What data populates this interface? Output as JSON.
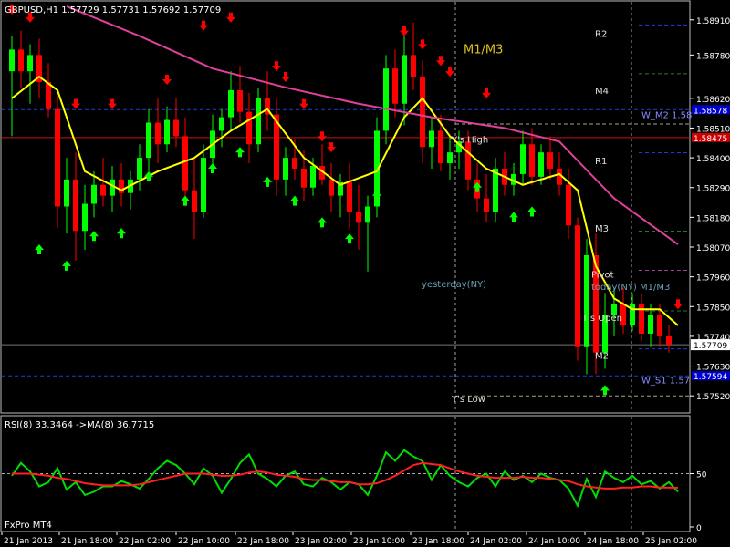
{
  "chart_data": [
    {
      "type": "candlestick",
      "title": "GBPUSD,H1  1.57729 1.57731 1.57692 1.57709",
      "current_price": "1.57709",
      "y_ticks": [
        "1.58910",
        "1.58780",
        "1.58620",
        "1.58510",
        "1.58400",
        "1.58290",
        "1.58180",
        "1.58070",
        "1.57960",
        "1.57850",
        "1.57740",
        "1.57630",
        "1.57520"
      ],
      "ylim": [
        1.5746,
        1.5898
      ],
      "level_boxes": [
        {
          "label": "1.58475",
          "price": 1.58475,
          "bg": "#cc0000"
        },
        {
          "label": "1.58578",
          "price": 1.58578,
          "bg": "#0000cc"
        },
        {
          "label": "1.57594",
          "price": 1.57594,
          "bg": "#0000cc"
        }
      ],
      "candles": [
        [
          1.5872,
          1.5885,
          1.5848,
          1.588
        ],
        [
          1.588,
          1.5887,
          1.5866,
          1.5872
        ],
        [
          1.5872,
          1.5882,
          1.586,
          1.5878
        ],
        [
          1.5878,
          1.5884,
          1.5862,
          1.5868
        ],
        [
          1.5868,
          1.5875,
          1.5855,
          1.5858
        ],
        [
          1.5858,
          1.5863,
          1.5814,
          1.5822
        ],
        [
          1.5822,
          1.584,
          1.5812,
          1.5832
        ],
        [
          1.5832,
          1.5842,
          1.5802,
          1.5813
        ],
        [
          1.5813,
          1.583,
          1.5806,
          1.5823
        ],
        [
          1.5823,
          1.5835,
          1.5818,
          1.583
        ],
        [
          1.583,
          1.584,
          1.5822,
          1.5826
        ],
        [
          1.5826,
          1.5837,
          1.582,
          1.5832
        ],
        [
          1.5832,
          1.5838,
          1.5822,
          1.5827
        ],
        [
          1.5827,
          1.5835,
          1.5821,
          1.5832
        ],
        [
          1.5832,
          1.5845,
          1.5828,
          1.584
        ],
        [
          1.584,
          1.5858,
          1.5835,
          1.5853
        ],
        [
          1.5853,
          1.5862,
          1.5838,
          1.5845
        ],
        [
          1.5845,
          1.5859,
          1.5842,
          1.5854
        ],
        [
          1.5854,
          1.5862,
          1.5844,
          1.5848
        ],
        [
          1.5848,
          1.5855,
          1.5822,
          1.5828
        ],
        [
          1.5828,
          1.584,
          1.581,
          1.582
        ],
        [
          1.582,
          1.5845,
          1.5818,
          1.584
        ],
        [
          1.584,
          1.5856,
          1.5836,
          1.585
        ],
        [
          1.585,
          1.5858,
          1.5844,
          1.5855
        ],
        [
          1.5855,
          1.5872,
          1.585,
          1.5865
        ],
        [
          1.5865,
          1.5874,
          1.5853,
          1.5857
        ],
        [
          1.5857,
          1.5864,
          1.5838,
          1.5845
        ],
        [
          1.5845,
          1.5866,
          1.5842,
          1.5862
        ],
        [
          1.5862,
          1.5872,
          1.585,
          1.5856
        ],
        [
          1.5856,
          1.5862,
          1.5826,
          1.5832
        ],
        [
          1.5832,
          1.5844,
          1.5826,
          1.584
        ],
        [
          1.584,
          1.5847,
          1.5832,
          1.5836
        ],
        [
          1.5836,
          1.5843,
          1.5824,
          1.5829
        ],
        [
          1.5829,
          1.584,
          1.5826,
          1.5837
        ],
        [
          1.5837,
          1.5845,
          1.583,
          1.5832
        ],
        [
          1.5832,
          1.5838,
          1.582,
          1.5826
        ],
        [
          1.5826,
          1.5834,
          1.5818,
          1.5831
        ],
        [
          1.5831,
          1.5838,
          1.5814,
          1.582
        ],
        [
          1.582,
          1.583,
          1.5806,
          1.5816
        ],
        [
          1.5816,
          1.5826,
          1.5798,
          1.5822
        ],
        [
          1.5822,
          1.5855,
          1.5818,
          1.585
        ],
        [
          1.585,
          1.5878,
          1.5845,
          1.5873
        ],
        [
          1.5873,
          1.588,
          1.5855,
          1.586
        ],
        [
          1.586,
          1.5885,
          1.5852,
          1.5878
        ],
        [
          1.5878,
          1.589,
          1.5865,
          1.587
        ],
        [
          1.587,
          1.5876,
          1.5838,
          1.5844
        ],
        [
          1.5844,
          1.5855,
          1.5836,
          1.585
        ],
        [
          1.585,
          1.5856,
          1.5835,
          1.5838
        ],
        [
          1.5838,
          1.5848,
          1.5832,
          1.5842
        ],
        [
          1.5842,
          1.585,
          1.5836,
          1.5846
        ],
        [
          1.5846,
          1.585,
          1.5828,
          1.5832
        ],
        [
          1.5832,
          1.5838,
          1.582,
          1.5825
        ],
        [
          1.5825,
          1.5834,
          1.5816,
          1.582
        ],
        [
          1.582,
          1.584,
          1.5816,
          1.5836
        ],
        [
          1.5836,
          1.5842,
          1.5826,
          1.583
        ],
        [
          1.583,
          1.5838,
          1.5826,
          1.5834
        ],
        [
          1.5834,
          1.585,
          1.583,
          1.5845
        ],
        [
          1.5845,
          1.5851,
          1.583,
          1.5833
        ],
        [
          1.5833,
          1.5845,
          1.583,
          1.5842
        ],
        [
          1.5842,
          1.5848,
          1.5832,
          1.5836
        ],
        [
          1.5836,
          1.5842,
          1.5826,
          1.583
        ],
        [
          1.583,
          1.5836,
          1.581,
          1.5815
        ],
        [
          1.5815,
          1.5818,
          1.5765,
          1.577
        ],
        [
          1.577,
          1.581,
          1.576,
          1.5804
        ],
        [
          1.5804,
          1.5812,
          1.576,
          1.5768
        ],
        [
          1.5768,
          1.579,
          1.5762,
          1.5782
        ],
        [
          1.5782,
          1.5792,
          1.5774,
          1.5786
        ],
        [
          1.5786,
          1.5792,
          1.5775,
          1.5778
        ],
        [
          1.5778,
          1.579,
          1.5776,
          1.5786
        ],
        [
          1.5786,
          1.579,
          1.5772,
          1.5775
        ],
        [
          1.5775,
          1.5786,
          1.577,
          1.5782
        ],
        [
          1.5782,
          1.5786,
          1.577,
          1.5774
        ],
        [
          1.5774,
          1.5778,
          1.5768,
          1.5771
        ]
      ],
      "ma": [
        {
          "name": "MA yellow",
          "color": "#ffff00",
          "points": [
            [
              0,
              1.5862
            ],
            [
              3,
              1.587
            ],
            [
              5,
              1.5865
            ],
            [
              8,
              1.5835
            ],
            [
              12,
              1.5828
            ],
            [
              16,
              1.5835
            ],
            [
              20,
              1.584
            ],
            [
              24,
              1.585
            ],
            [
              28,
              1.5858
            ],
            [
              32,
              1.584
            ],
            [
              36,
              1.583
            ],
            [
              40,
              1.5835
            ],
            [
              43,
              1.5855
            ],
            [
              45,
              1.5862
            ],
            [
              48,
              1.5848
            ],
            [
              52,
              1.5836
            ],
            [
              56,
              1.583
            ],
            [
              60,
              1.5834
            ],
            [
              62,
              1.5828
            ],
            [
              64,
              1.58
            ],
            [
              66,
              1.5788
            ],
            [
              68,
              1.5784
            ],
            [
              71,
              1.5784
            ],
            [
              73,
              1.5778
            ]
          ]
        },
        {
          "name": "MA pink",
          "color": "#e0409a",
          "points": [
            [
              6,
              1.5896
            ],
            [
              14,
              1.5885
            ],
            [
              22,
              1.5873
            ],
            [
              30,
              1.5866
            ],
            [
              38,
              1.586
            ],
            [
              46,
              1.5855
            ],
            [
              54,
              1.5851
            ],
            [
              60,
              1.5846
            ],
            [
              66,
              1.5825
            ],
            [
              73,
              1.5808
            ]
          ]
        }
      ],
      "h_lines": [
        {
          "price": 1.58891,
          "color": "#1b3fd6",
          "dash": true,
          "x_from": 700
        },
        {
          "price": 1.58578,
          "color": "#1b3fd6",
          "dash": true,
          "x_from": 0
        },
        {
          "price": 1.58475,
          "color": "#c81414",
          "dash": false,
          "x_from": 0
        },
        {
          "price": 1.57594,
          "color": "#1b3fd6",
          "dash": true,
          "x_from": 0
        },
        {
          "price": 1.57709,
          "color": "#777777",
          "dash": false,
          "x_from": 0
        },
        {
          "price": 1.58711,
          "color": "#2a7a2a",
          "dash": true,
          "x_from": 700
        },
        {
          "price": 1.58419,
          "color": "#1b3fd6",
          "dash": true,
          "x_from": 700
        },
        {
          "price": 1.58129,
          "color": "#2a7a2a",
          "dash": true,
          "x_from": 700
        },
        {
          "price": 1.57984,
          "color": "#a040a0",
          "dash": true,
          "x_from": 700
        },
        {
          "price": 1.57834,
          "color": "#2a7a2a",
          "dash": true,
          "x_from": 700
        },
        {
          "price": 1.57694,
          "color": "#1b3fd6",
          "dash": true,
          "x_from": 700
        },
        {
          "price": 1.58525,
          "color": "#b0a080",
          "dash": true,
          "x_from": 499
        },
        {
          "price": 1.5752,
          "color": "#b0a080",
          "dash": true,
          "x_from": 499
        }
      ],
      "v_lines": [
        {
          "time": "23 Jan 22:00",
          "color": "#a0a0a0"
        },
        {
          "time": "24 Jan 22:00",
          "color": "#a0a0a0"
        }
      ],
      "labels": [
        {
          "text": "R2",
          "price": 1.5886,
          "color": "#e0e0e0",
          "pos": "right"
        },
        {
          "text": "M4",
          "price": 1.5865,
          "color": "#e0e0e0",
          "pos": "right"
        },
        {
          "text": "R1",
          "price": 1.5839,
          "color": "#e0e0e0",
          "pos": "right"
        },
        {
          "text": "M3",
          "price": 1.5814,
          "color": "#e0e0e0",
          "pos": "right"
        },
        {
          "text": "M2",
          "price": 1.5767,
          "color": "#e0e0e0",
          "pos": "right"
        },
        {
          "text": "W_M2 1.58",
          "price": 1.5856,
          "color": "#8a8aff",
          "pos": "far"
        },
        {
          "text": "W_S1 1.57",
          "price": 1.5758,
          "color": "#8a8aff",
          "pos": "far"
        },
        {
          "text": "M1/M3",
          "price": 1.588,
          "color": "#e0c020",
          "pos": "mid",
          "size": 13
        },
        {
          "text": "Y's High",
          "price": 1.5847,
          "color": "#e0e0e0",
          "pos": "low"
        },
        {
          "text": "Y's Low",
          "price": 1.5751,
          "color": "#e0e0e0",
          "pos": "low"
        },
        {
          "text": "yesterday(NY)",
          "price": 1.57935,
          "color": "#6a9fb5",
          "pos": "y"
        },
        {
          "text": "Pivot",
          "price": 1.5797,
          "color": "#e0e0e0",
          "pos": "piv"
        },
        {
          "text": "today(NY) M1/M3",
          "price": 1.57925,
          "color": "#6a9fb5",
          "pos": "tod"
        },
        {
          "text": "T's Open",
          "price": 1.5781,
          "color": "#e0e0e0",
          "pos": "top"
        }
      ],
      "up_arrows": [
        [
          3,
          1.5808
        ],
        [
          6,
          1.5802
        ],
        [
          9,
          1.5813
        ],
        [
          12,
          1.5814
        ],
        [
          15,
          1.5835
        ],
        [
          19,
          1.5826
        ],
        [
          22,
          1.5838
        ],
        [
          25,
          1.5844
        ],
        [
          28,
          1.5833
        ],
        [
          31,
          1.5826
        ],
        [
          34,
          1.5818
        ],
        [
          37,
          1.5812
        ],
        [
          40,
          1.5828
        ],
        [
          51,
          1.5831
        ],
        [
          55,
          1.582
        ],
        [
          57,
          1.5822
        ],
        [
          65,
          1.5756
        ]
      ],
      "down_arrows": [
        [
          0,
          1.5893
        ],
        [
          2,
          1.589
        ],
        [
          7,
          1.5858
        ],
        [
          11,
          1.5858
        ],
        [
          17,
          1.5867
        ],
        [
          21,
          1.5887
        ],
        [
          24,
          1.589
        ],
        [
          29,
          1.5872
        ],
        [
          30,
          1.5868
        ],
        [
          32,
          1.5858
        ],
        [
          34,
          1.5846
        ],
        [
          35,
          1.5842
        ],
        [
          43,
          1.5885
        ],
        [
          45,
          1.588
        ],
        [
          47,
          1.5874
        ],
        [
          48,
          1.587
        ],
        [
          52,
          1.5862
        ],
        [
          73,
          1.5784
        ]
      ],
      "x_labels": [
        "21 Jan 2013",
        "21 Jan 18:00",
        "22 Jan 02:00",
        "22 Jan 10:00",
        "22 Jan 18:00",
        "23 Jan 02:00",
        "23 Jan 10:00",
        "23 Jan 18:00",
        "24 Jan 02:00",
        "24 Jan 10:00",
        "24 Jan 18:00",
        "25 Jan 02:00"
      ],
      "colors": {
        "bull": "#00ff00",
        "bear": "#ff0000",
        "background": "#000000",
        "axis_text": "#ffffff",
        "frame": "#ffffff"
      }
    },
    {
      "type": "line",
      "title": "RSI(8) 33.3464  ->MA(8) 36.7715",
      "y_ticks": [
        "50",
        "0"
      ],
      "ylim": [
        0,
        100
      ],
      "series": [
        {
          "name": "RSI(8)",
          "color": "#00dd00",
          "values": [
            48,
            60,
            52,
            38,
            42,
            55,
            35,
            42,
            30,
            33,
            38,
            38,
            43,
            40,
            36,
            45,
            55,
            62,
            58,
            50,
            40,
            55,
            48,
            32,
            45,
            60,
            68,
            50,
            45,
            38,
            48,
            52,
            40,
            38,
            46,
            42,
            35,
            42,
            40,
            30,
            48,
            70,
            62,
            72,
            66,
            62,
            44,
            58,
            48,
            42,
            38,
            46,
            50,
            38,
            52,
            44,
            48,
            42,
            50,
            46,
            44,
            36,
            20,
            45,
            28,
            52,
            46,
            42,
            48,
            40,
            43,
            36,
            42,
            33
          ]
        },
        {
          "name": "MA(8)",
          "color": "#ff2020",
          "values": [
            50,
            50,
            50,
            49,
            48,
            46,
            45,
            43,
            41,
            40,
            39,
            39,
            39,
            39,
            40,
            42,
            44,
            46,
            48,
            50,
            50,
            50,
            49,
            48,
            48,
            49,
            51,
            52,
            51,
            49,
            48,
            47,
            45,
            44,
            44,
            43,
            42,
            42,
            40,
            40,
            41,
            44,
            48,
            53,
            58,
            60,
            59,
            58,
            55,
            52,
            50,
            48,
            47,
            46,
            46,
            46,
            47,
            46,
            46,
            45,
            44,
            43,
            40,
            38,
            37,
            36,
            36,
            37,
            37,
            38,
            38,
            37,
            37,
            36.8
          ]
        }
      ],
      "label": "FxPro MT4"
    }
  ]
}
